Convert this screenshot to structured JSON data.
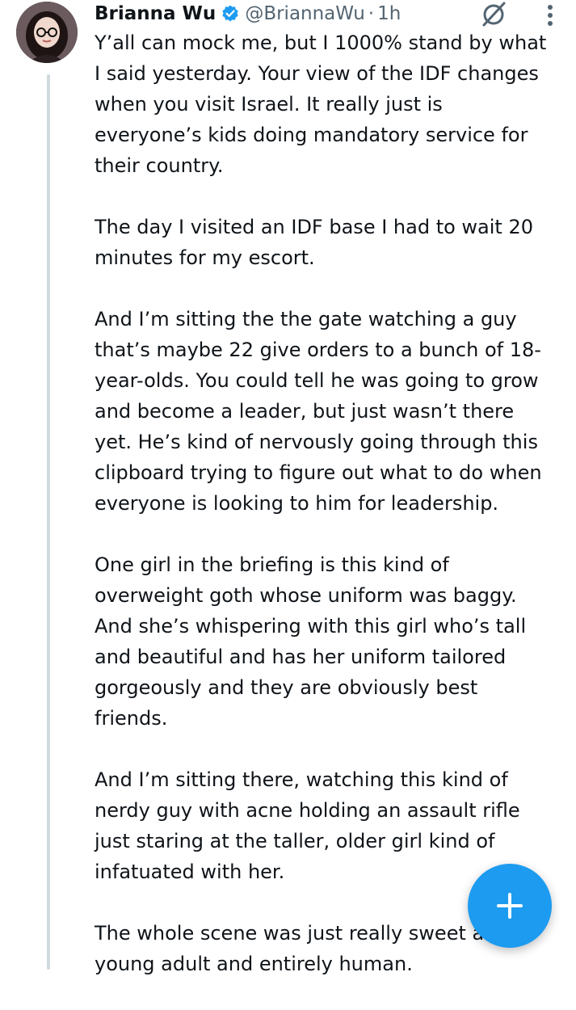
{
  "tweet": {
    "display_name": "Brianna Wu",
    "handle": "@BriannaWu",
    "separator": "·",
    "time": "1h",
    "paragraphs": [
      "Y’all can mock me, but I 1000% stand by what I said yesterday. Your view of the IDF changes when you visit Israel. It really just is everyone’s kids doing mandatory service for their country.",
      "The day I visited an IDF base I had to wait 20 minutes for my escort.",
      "And I’m sitting the the gate watching a guy that’s maybe 22 give orders to a bunch of 18-year-olds. You could tell he was going to grow and become a leader, but just wasn’t there yet. He’s kind of nervously going through this clipboard trying to figure out what to do when everyone is looking to him for leadership.",
      "One girl in the briefing is this kind of overweight goth whose uniform was baggy. And she’s whispering with this girl who’s tall and beautiful and has her uniform tailored gorgeously and they are obviously best friends.",
      "And I’m sitting there, watching this kind of nerdy guy with acne holding an assault rifle just staring at the taller, older girl kind of infatuated with her.",
      "The whole scene was just really sweet and young adult and entirely human."
    ]
  },
  "icons": {
    "avatar": "avatar",
    "verified": "verified-badge-icon",
    "grok": "grok-icon",
    "more": "more-options-icon",
    "compose": "compose-plus-icon"
  },
  "colors": {
    "accent": "#1d9bf0",
    "text": "#0f1419",
    "secondary_text": "#536471",
    "thread_line": "#cfd9de"
  }
}
